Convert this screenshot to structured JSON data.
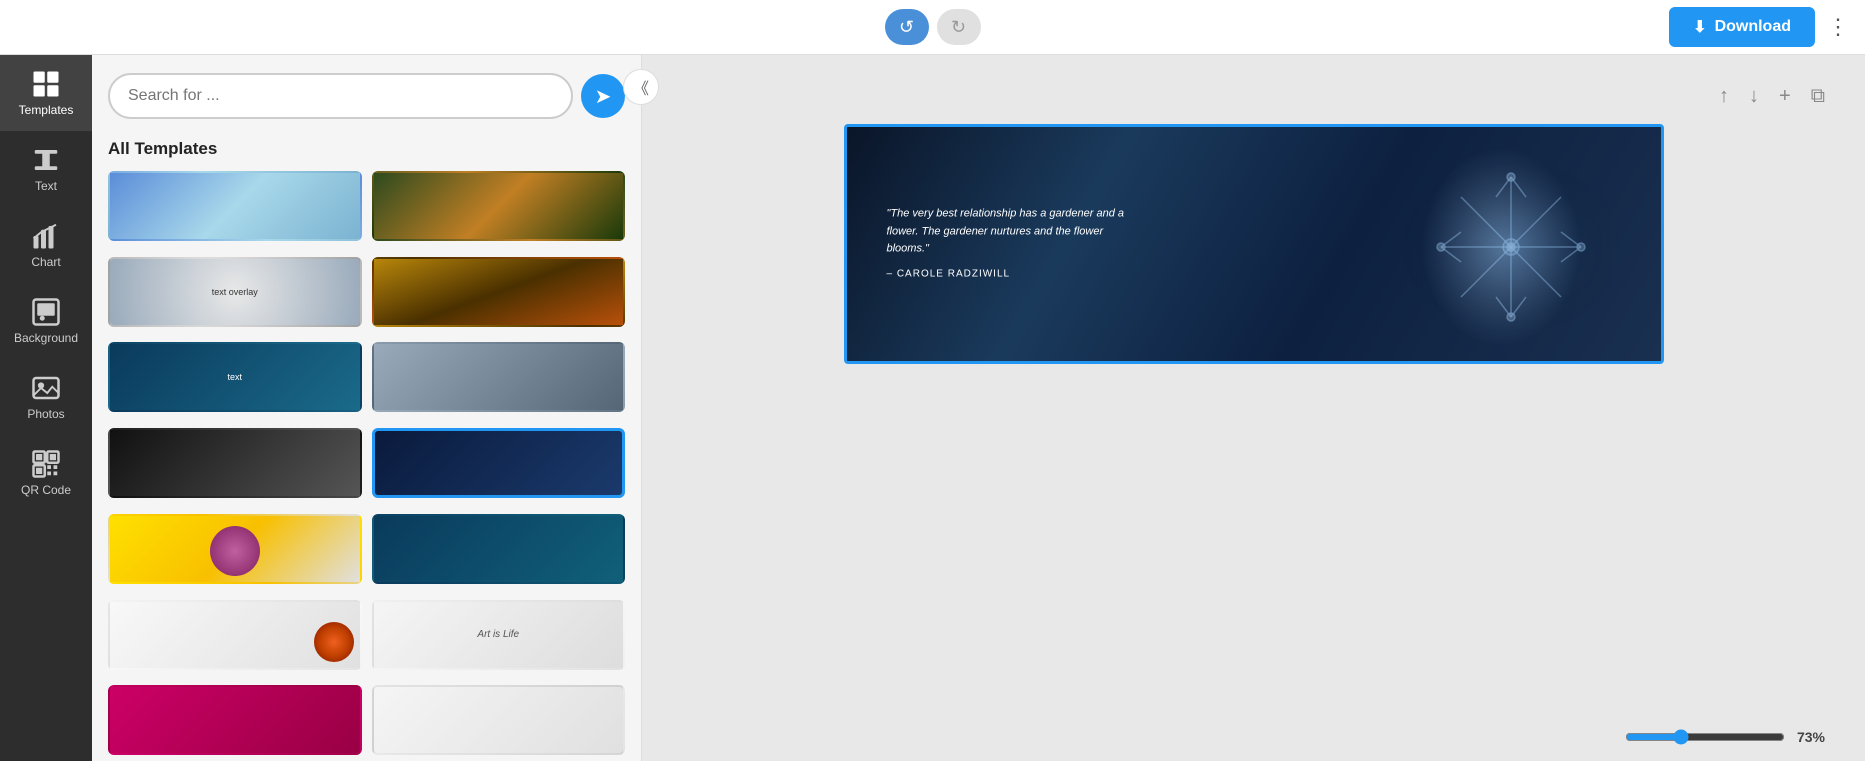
{
  "topbar": {
    "undo_label": "↺",
    "redo_label": "↻",
    "download_label": "Download",
    "download_icon": "⬇",
    "more_icon": "⋮"
  },
  "sidebar": {
    "items": [
      {
        "id": "templates",
        "label": "Templates",
        "active": true
      },
      {
        "id": "text",
        "label": "Text",
        "active": false
      },
      {
        "id": "chart",
        "label": "Chart",
        "active": false
      },
      {
        "id": "background",
        "label": "Background",
        "active": false
      },
      {
        "id": "photos",
        "label": "Photos",
        "active": false
      },
      {
        "id": "qrcode",
        "label": "QR Code",
        "active": false
      }
    ]
  },
  "templates_panel": {
    "search_placeholder": "Search for ...",
    "section_label": "All Templates",
    "templates": [
      {
        "id": 1,
        "class": "t1",
        "label": ""
      },
      {
        "id": 2,
        "class": "t2",
        "label": ""
      },
      {
        "id": 3,
        "class": "t3",
        "label": ""
      },
      {
        "id": 4,
        "class": "t4",
        "label": ""
      },
      {
        "id": 5,
        "class": "t5",
        "label": ""
      },
      {
        "id": 6,
        "class": "t6",
        "label": ""
      },
      {
        "id": 7,
        "class": "t7",
        "label": ""
      },
      {
        "id": 8,
        "class": "t8",
        "label": "",
        "selected": true
      },
      {
        "id": 9,
        "class": "t9",
        "label": ""
      },
      {
        "id": 10,
        "class": "t10",
        "label": ""
      },
      {
        "id": 11,
        "class": "t11",
        "label": ""
      },
      {
        "id": 12,
        "class": "t12",
        "label": ""
      },
      {
        "id": 13,
        "class": "t13",
        "label": ""
      },
      {
        "id": 14,
        "class": "t14",
        "label": ""
      }
    ]
  },
  "canvas": {
    "quote": "\"The very best relationship has a gardener and a flower. The gardener nurtures and the flower blooms.\"",
    "author": "– CAROLE RADZIWILL",
    "zoom_value": 73,
    "zoom_label": "73%"
  },
  "toolbar": {
    "up_icon": "↑",
    "down_icon": "↓",
    "add_icon": "+",
    "copy_icon": "⧉"
  }
}
